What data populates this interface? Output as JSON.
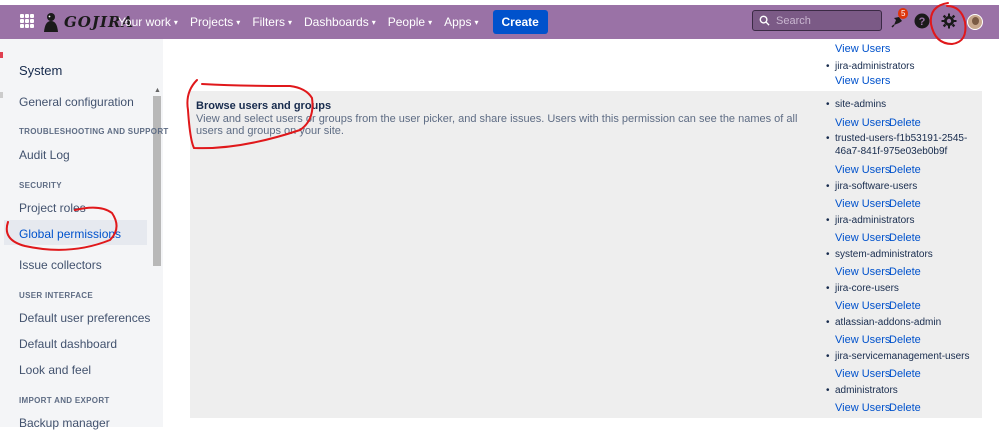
{
  "topbar": {
    "logo_text": "GOJIRA",
    "nav": [
      {
        "label": "Your work"
      },
      {
        "label": "Projects"
      },
      {
        "label": "Filters"
      },
      {
        "label": "Dashboards"
      },
      {
        "label": "People"
      },
      {
        "label": "Apps"
      }
    ],
    "create_label": "Create",
    "search_placeholder": "Search",
    "notifications_count": "5",
    "icons": [
      "apps-grid-icon",
      "notifications-icon",
      "help-icon",
      "settings-icon",
      "avatar"
    ],
    "bg_color": "#9a72a6",
    "create_color": "#0052cc"
  },
  "sidebar": {
    "title": "System",
    "sections": [
      {
        "items": [
          "General configuration"
        ]
      },
      {
        "heading": "TROUBLESHOOTING AND SUPPORT",
        "items": [
          "Audit Log"
        ]
      },
      {
        "heading": "SECURITY",
        "items": [
          "Project roles",
          "Global permissions",
          "Issue collectors"
        ]
      },
      {
        "heading": "USER INTERFACE",
        "items": [
          "Default user preferences",
          "Default dashboard",
          "Look and feel"
        ]
      },
      {
        "heading": "IMPORT AND EXPORT",
        "items": [
          "Backup manager"
        ]
      }
    ],
    "active_item": "Global permissions"
  },
  "main": {
    "top_groups": {
      "view_users_1": "View Users",
      "group_1": "jira-administrators",
      "view_users_2": "View Users"
    },
    "permission": {
      "title": "Browse users and groups",
      "description": "View and select users or groups from the user picker, and share issues. Users with this permission can see the names of all users and groups on your site."
    },
    "groups": [
      {
        "name": "site-admins",
        "view": "View Users",
        "delete": "Delete"
      },
      {
        "name": "trusted-users-f1b53191-2545-46a7-841f-975e03eb0b9f",
        "view": "View Users",
        "delete": "Delete"
      },
      {
        "name": "jira-software-users",
        "view": "View Users",
        "delete": "Delete"
      },
      {
        "name": "jira-administrators",
        "view": "View Users",
        "delete": "Delete"
      },
      {
        "name": "system-administrators",
        "view": "View Users",
        "delete": "Delete"
      },
      {
        "name": "jira-core-users",
        "view": "View Users",
        "delete": "Delete"
      },
      {
        "name": "atlassian-addons-admin",
        "view": "View Users",
        "delete": "Delete"
      },
      {
        "name": "jira-servicemanagement-users",
        "view": "View Users",
        "delete": "Delete"
      },
      {
        "name": "administrators",
        "view": "View Users",
        "delete": "Delete"
      }
    ],
    "link_color": "#0052cc",
    "card_color": "#eeeeee"
  },
  "annotation_color": "#e0181b"
}
